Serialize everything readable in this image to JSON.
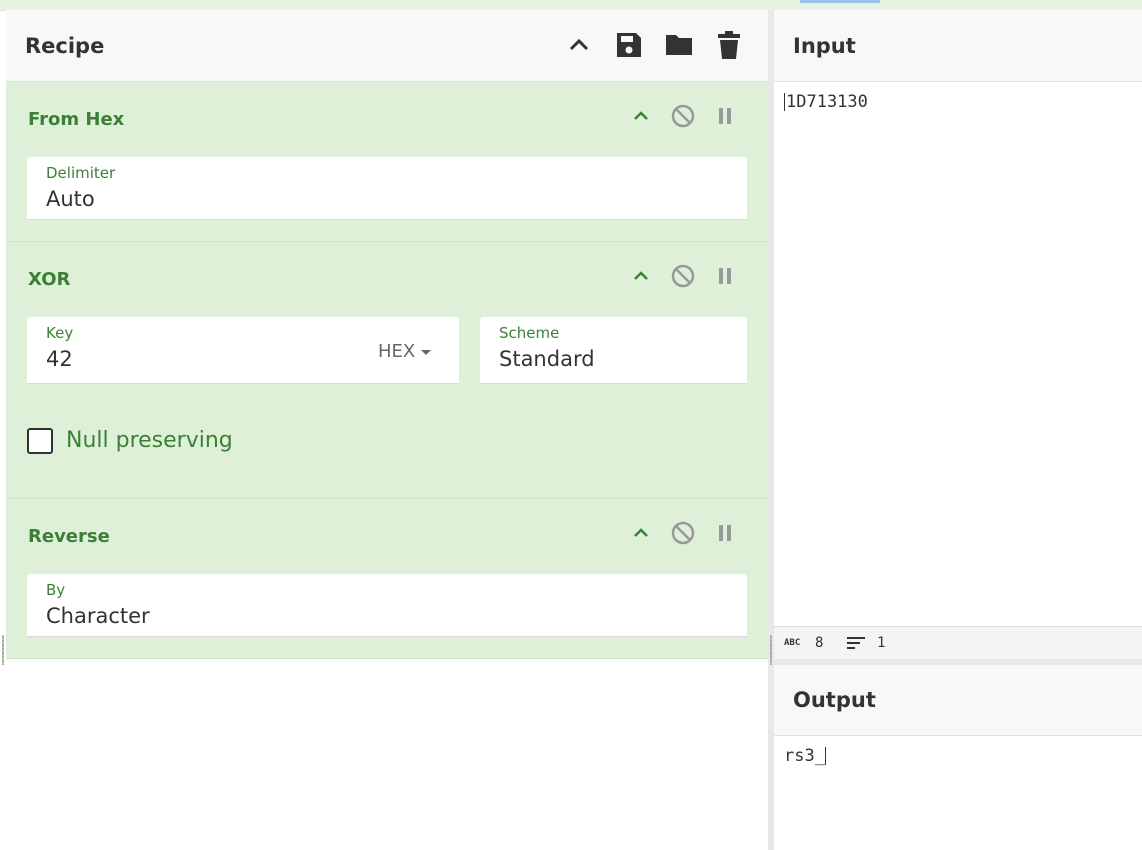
{
  "recipe": {
    "title": "Recipe",
    "header_icons": [
      "chevron-up-icon",
      "save-icon",
      "folder-icon",
      "trash-icon"
    ],
    "operations": [
      {
        "name": "From Hex",
        "fields": [
          {
            "label": "Delimiter",
            "value": "Auto"
          }
        ]
      },
      {
        "name": "XOR",
        "fields": [
          {
            "label": "Key",
            "value": "42",
            "type_selected": "HEX"
          },
          {
            "label": "Scheme",
            "value": "Standard"
          }
        ],
        "checkbox": {
          "label": "Null preserving",
          "checked": false
        }
      },
      {
        "name": "Reverse",
        "fields": [
          {
            "label": "By",
            "value": "Character"
          }
        ]
      }
    ],
    "op_controls": [
      "chevron-up-icon",
      "disable-icon",
      "pause-icon"
    ]
  },
  "input": {
    "title": "Input",
    "text": "1D713130",
    "status": {
      "chars_icon": "ABC",
      "chars": "8",
      "lines": "1"
    }
  },
  "output": {
    "title": "Output",
    "text": "rs3_"
  },
  "colors": {
    "accent_green": "#3c8037",
    "op_background": "#dff0d8",
    "header_background": "#f8f8f8"
  }
}
